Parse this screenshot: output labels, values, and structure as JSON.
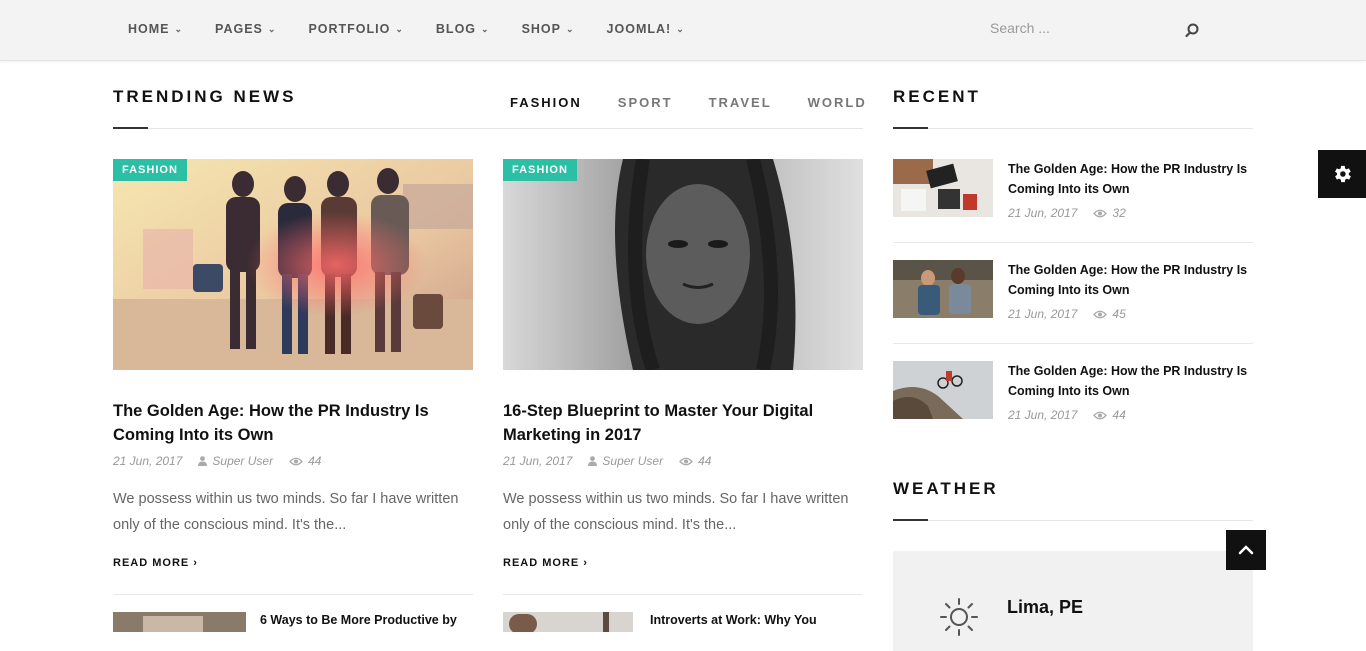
{
  "nav": {
    "items": [
      {
        "label": "HOME"
      },
      {
        "label": "PAGES"
      },
      {
        "label": "PORTFOLIO"
      },
      {
        "label": "BLOG"
      },
      {
        "label": "SHOP"
      },
      {
        "label": "JOOMLA!"
      }
    ],
    "search_placeholder": "Search ..."
  },
  "trending": {
    "title": "TRENDING NEWS",
    "tabs": [
      "FASHION",
      "SPORT",
      "TRAVEL",
      "WORLD"
    ],
    "active_tab": "FASHION",
    "cards": [
      {
        "badge": "FASHION",
        "title": "The Golden Age: How the PR Industry Is Coming Into its Own",
        "date": "21 Jun, 2017",
        "author": "Super User",
        "views": "44",
        "excerpt": "We possess within us two minds. So far I have written only of the conscious mind. It's the...",
        "read_more": "READ MORE"
      },
      {
        "badge": "FASHION",
        "title": "16-Step Blueprint to Master Your Digital Marketing in 2017",
        "date": "21 Jun, 2017",
        "author": "Super User",
        "views": "44",
        "excerpt": "We possess within us two minds. So far I have written only of the conscious mind. It's the...",
        "read_more": "READ MORE"
      }
    ],
    "more": [
      {
        "title": "6 Ways to Be More Productive by"
      },
      {
        "title": "Introverts at Work: Why You"
      }
    ]
  },
  "recent": {
    "title": "RECENT",
    "items": [
      {
        "title": "The Golden Age: How the PR Industry Is Coming Into its Own",
        "date": "21 Jun, 2017",
        "views": "32"
      },
      {
        "title": "The Golden Age: How the PR Industry Is Coming Into its Own",
        "date": "21 Jun, 2017",
        "views": "45"
      },
      {
        "title": "The Golden Age: How the PR Industry Is Coming Into its Own",
        "date": "21 Jun, 2017",
        "views": "44"
      }
    ]
  },
  "weather": {
    "title": "WEATHER",
    "city": "Lima, PE"
  },
  "colors": {
    "accent": "#2bbfa5",
    "dark": "#111111"
  },
  "icons": {
    "search": "search-icon",
    "chevron": "chevron-down-icon",
    "user": "user-icon",
    "views": "eye-icon",
    "settings": "gear-icon",
    "to_top": "chevron-up-icon",
    "weather": "sun-icon"
  }
}
